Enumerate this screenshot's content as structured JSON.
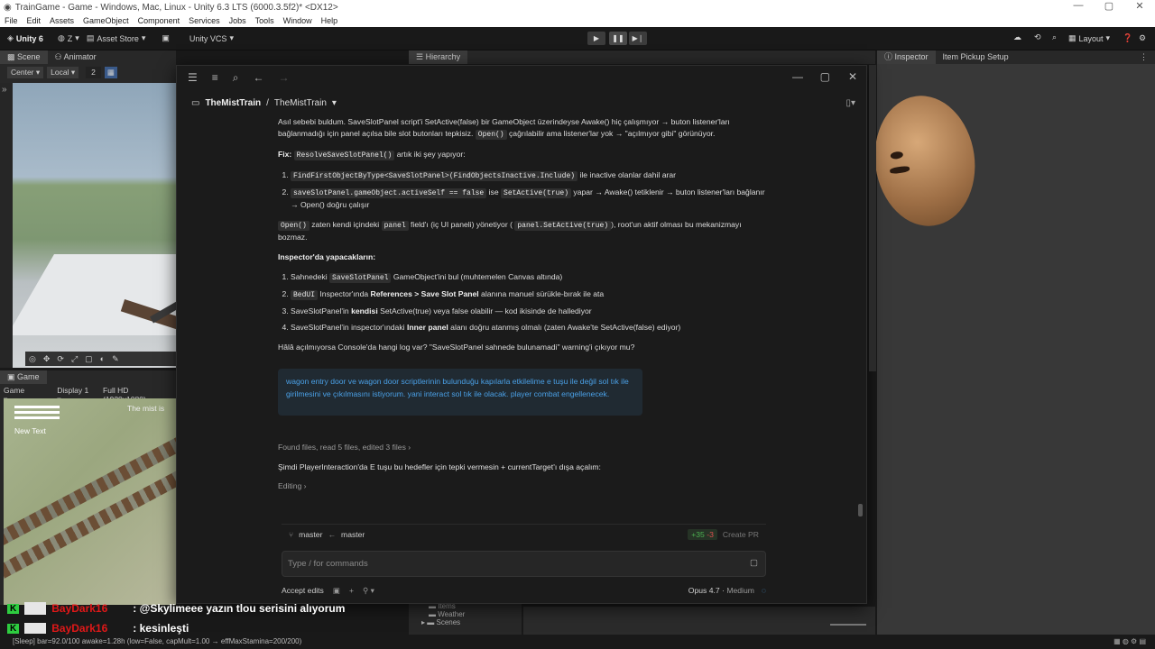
{
  "window": {
    "title": "TrainGame - Game - Windows, Mac, Linux - Unity 6.3 LTS (6000.3.5f2)* <DX12>"
  },
  "menu": [
    "File",
    "Edit",
    "Assets",
    "GameObject",
    "Component",
    "Services",
    "Jobs",
    "Tools",
    "Window",
    "Help"
  ],
  "toolbar": {
    "unity": "Unity 6",
    "user": "Z",
    "asset_store": "Asset Store",
    "vcs": "Unity VCS",
    "layout": "Layout"
  },
  "scene": {
    "tab_scene": "Scene",
    "tab_animator": "Animator",
    "pivot": "Center",
    "space": "Local",
    "grid": "2"
  },
  "game": {
    "tab": "Game",
    "mode": "Game",
    "display": "Display 1",
    "resolution": "Full HD (1920x1080)",
    "new_text": "New Text",
    "hud_text": "The mist is"
  },
  "hierarchy": {
    "tab": "Hierarchy",
    "items": [
      "Items",
      "Weather",
      "Scenes"
    ]
  },
  "inspector": {
    "tab": "Inspector",
    "tab2": "Item Pickup Setup"
  },
  "chat": {
    "breadcrumb_project": "TheMistTrain",
    "breadcrumb_sep": "/",
    "breadcrumb_repo": "TheMistTrain",
    "para1": "Asıl sebebi buldum. SaveSlotPanel script'i SetActive(false) bir GameObject üzerindeyse Awake() hiç çalışmıyor → buton listener'ları bağlanmadığı için panel açılsa bile slot butonları tepkisiz.",
    "para1_code": "Open()",
    "para1_end": "çağrılabilir ama listener'lar yok → \"açılmıyor gibi\" görünüyor.",
    "fix_label": "Fix:",
    "fix_code": "ResolveSaveSlotPanel()",
    "fix_text": "artık iki şey yapıyor:",
    "fix1_code": "FindFirstObjectByType<SaveSlotPanel>(FindObjectsInactive.Include)",
    "fix1_text": "ile inactive olanlar dahil arar",
    "fix2_code": "saveSlotPanel.gameObject.activeSelf == false",
    "fix2_mid": "ise",
    "fix2_code2": "SetActive(true)",
    "fix2_text": "yapar → Awake() tetiklenir → buton listener'ları bağlanır → Open() doğru çalışır",
    "para3_code": "Open()",
    "para3_a": "zaten kendi içindeki",
    "para3_code2": "panel",
    "para3_b": "field'ı (iç UI paneli) yönetiyor (",
    "para3_code3": "panel.SetActive(true)",
    "para3_c": "), root'un aktif olması bu mekanizmayı bozmaz.",
    "inspector_heading": "Inspector'da yapacakların:",
    "step1_a": "Sahnedeki",
    "step1_code": "SaveSlotPanel",
    "step1_b": "GameObject'ini bul (muhtemelen Canvas altında)",
    "step2_code": "BedUI",
    "step2_a": "Inspector'ında",
    "step2_bold": "References > Save Slot Panel",
    "step2_b": "alanına manuel sürükle-bırak ile ata",
    "step3_a": "SaveSlotPanel'in",
    "step3_bold": "kendisi",
    "step3_b": "SetActive(true) veya false olabilir — kod ikisinde de hallediyor",
    "step4_a": "SaveSlotPanel'in inspector'ındaki",
    "step4_bold": "Inner panel",
    "step4_b": "alanı doğru atanmış olmalı (zaten Awake'te SetActive(false) ediyor)",
    "question": "Hâlâ açılmıyorsa Console'da hangi log var? \"SaveSlotPanel sahnede bulunamadi\" warning'i çıkıyor mu?",
    "user_message": "wagon entry door  ve wagon door scriptlerinin bulunduğu kapılarla etkilelime e tuşu ile değil sol tık ile girilmesini ve çıkılmasını istiyorum.  yani interact sol tık ile olacak. player combat engellenecek.",
    "found": "Found files, read 5 files, edited 3 files",
    "now": "Şimdi PlayerInteraction'da E tuşu bu hedefler için tepki vermesin + currentTarget'ı dışa açalım:",
    "editing": "Editing",
    "branch_from": "master",
    "branch_to": "master",
    "added": "+35",
    "removed": "-3",
    "create_pr": "Create PR",
    "input_placeholder": "Type / for commands",
    "accept": "Accept edits",
    "model": "Opus 4.7",
    "effort": "Medium"
  },
  "stream": [
    {
      "user": "BayDark16",
      "msg": ": @Skylimeee yazın tlou serisini alıyorum"
    },
    {
      "user": "BayDark16",
      "msg": ": kesinleşti"
    }
  ],
  "status": "[Sleep] bar=92.0/100 awake=1.28h (low=False, capMult=1.00 → effMaxStamina=200/200)",
  "colors": {
    "accent": "#4aa0e6",
    "added": "#4caf50",
    "removed": "#e05050",
    "twitch": "#2ecc40",
    "user": "#e01818"
  }
}
